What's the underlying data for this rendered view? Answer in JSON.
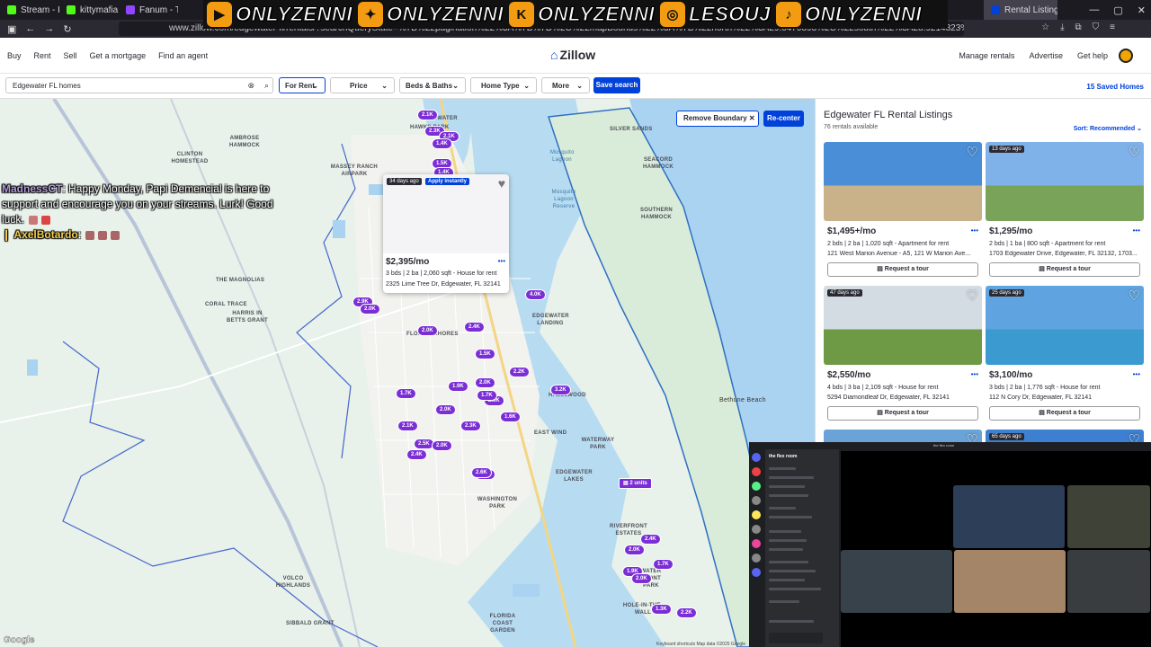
{
  "browser": {
    "tabs": [
      {
        "label": "Stream - Kick Dash",
        "color": "#53fc18"
      },
      {
        "label": "kittymafia Stream",
        "color": "#53fc18"
      },
      {
        "label": "Fanum - Twitch",
        "color": "#9146ff"
      },
      {
        "label": "Rental Listings",
        "color": "#0041d9"
      }
    ],
    "url": "www.zillow.com/edgewater-fl/rentals/?searchQueryState=%7B%22pagination%22%3A%7B%7D%2C%22mapBounds%22%3A%7B%22north%22%3A29.0470898%2C%22south%22%3A28.9214823%2C%22east%22%3A-80.8886216%2C%22west%22%3A-80.9892888%7D%2C%22regionSelection%22%3A"
  },
  "overlay": {
    "socials": [
      {
        "icon": "youtube-icon",
        "glyph": "▶",
        "handle": "ONLYZENNI"
      },
      {
        "icon": "twitter-icon",
        "glyph": "✦",
        "handle": "ONLYZENNI"
      },
      {
        "icon": "kick-icon",
        "glyph": "K",
        "handle": "ONLYZENNI"
      },
      {
        "icon": "instagram-icon",
        "glyph": "◎",
        "handle": "LESOUJ"
      },
      {
        "icon": "tiktok-icon",
        "glyph": "♪",
        "handle": "ONLYZENNI"
      }
    ],
    "chat": {
      "line1_user": "MadnessCT",
      "line1_text": ": Happy Monday, Papi Demencial is here to support and encourage you on your streams. Lurk! Good luck.",
      "line2_user": "AxelBotardo",
      "line2_text": ":"
    }
  },
  "zillow": {
    "nav_left": [
      "Buy",
      "Rent",
      "Sell",
      "Get a mortgage",
      "Find an agent"
    ],
    "logo": "Zillow",
    "nav_right": [
      "Manage rentals",
      "Advertise",
      "Get help"
    ],
    "search_value": "Edgewater FL homes",
    "filters": [
      {
        "label": "For Rent",
        "active": true
      },
      {
        "label": "Price",
        "active": false
      },
      {
        "label": "Beds & Baths",
        "active": false
      },
      {
        "label": "Home Type",
        "active": false
      },
      {
        "label": "More",
        "active": false
      }
    ],
    "save_search": "Save search",
    "saved_homes": "15 Saved Homes"
  },
  "map": {
    "remove_boundary": "Remove Boundary",
    "recenter": "Re-center",
    "labels": [
      "EDGEWATER",
      "HAWKS PARK",
      "SILVER SANDS",
      "MASSEY RANCH AIRPARK",
      "AMBROSE HAMMOCK",
      "CLINTON HOMESTEAD",
      "SEACORD HAMMOCK",
      "SOUTHERN HAMMOCK",
      "THE MAGNOLIAS",
      "CORAL TRACE",
      "HARRIS IN BETTS GRANT",
      "FLORIDA SHORES",
      "EDGEWATER LANDING",
      "HAZELWOOD",
      "EAST WIND",
      "WATERWAY PARK",
      "EDGEWATER LAKES",
      "WASHINGTON PARK",
      "RIVERFRONT ESTATES",
      "WATER FRONT PARK",
      "VOLCO HIGHLANDS",
      "SIBBALD GRANT",
      "FLORIDA COAST GARDEN",
      "HOLE-IN-THE-WALL",
      "Bethune Beach",
      "Google",
      "Mosquito Lagoon",
      "Mosquito Lagoon Reserve"
    ],
    "pins": [
      "2.1K",
      "2.3K",
      "2.1K",
      "1.4K",
      "1.5K",
      "1.4K",
      "2.1K",
      "2.4K",
      "4.0K",
      "2.9K",
      "2.0K",
      "2.0K",
      "2.4K",
      "1.5K",
      "2.2K",
      "2.0K",
      "1.9K",
      "2.0K",
      "1.7K",
      "2.6K",
      "3.2K",
      "1.7K",
      "2.0K",
      "1.6K",
      "2.1K",
      "2.3K",
      "2.5K",
      "2.0K",
      "2.4K",
      "2.6K",
      "2.0K",
      "2.4K",
      "1.7K",
      "1.9K",
      "2.0K",
      "1.3K",
      "2.2K"
    ],
    "units_pin": "2 units",
    "popup": {
      "days": "34 days ago",
      "instant": "Apply instantly",
      "price": "$2,395/mo",
      "meta": "3 bds | 2 ba | 2,060 sqft - House for rent",
      "addr": "2325 Lime Tree Dr, Edgewater, FL 32141"
    }
  },
  "listings": {
    "title": "Edgewater FL Rental Listings",
    "count": "76 rentals available",
    "sort": "Sort: Recommended",
    "cards": [
      {
        "days": "",
        "price": "$1,495+/mo",
        "meta": "2 bds | 2 ba | 1,020 sqft - Apartment for rent",
        "addr": "121 West Marion Avenue - A5, 121 W Marion Ave...",
        "tour": "Request a tour",
        "sky": "#4a8ed8",
        "ground": "#c9b28a"
      },
      {
        "days": "13 days ago",
        "price": "$1,295/mo",
        "meta": "2 bds | 1 ba | 800 sqft - Apartment for rent",
        "addr": "1703 Edgewater Drive, Edgewater, FL 32132, 1703...",
        "tour": "Request a tour",
        "sky": "#7fb2e8",
        "ground": "#7aa35a"
      },
      {
        "days": "47 days ago",
        "price": "$2,550/mo",
        "meta": "4 bds | 3 ba | 2,109 sqft - House for rent",
        "addr": "5294 Diamondleaf Dr, Edgewater, FL 32141",
        "tour": "Request a tour",
        "sky": "#d3dbe3",
        "ground": "#6f9a45"
      },
      {
        "days": "25 days ago",
        "price": "$3,100/mo",
        "meta": "3 bds | 2 ba | 1,776 sqft - House for rent",
        "addr": "112 N Cory Dr, Edgewater, FL 32141",
        "tour": "Request a tour",
        "sky": "#5fa4e0",
        "ground": "#3b9ad0"
      },
      {
        "days": "",
        "price": "",
        "meta": "",
        "addr": "",
        "tour": "",
        "sky": "#6aa3d8",
        "ground": "#6aa3d8"
      },
      {
        "days": "65 days ago",
        "price": "",
        "meta": "",
        "addr": "",
        "tour": "",
        "sky": "#3d7fd0",
        "ground": "#3d7fd0"
      }
    ]
  },
  "discord": {
    "server": "the flex room",
    "window_title": "the flex room"
  },
  "footer": {
    "map_note": "Keyboard shortcuts   Map data ©2025 Google"
  }
}
